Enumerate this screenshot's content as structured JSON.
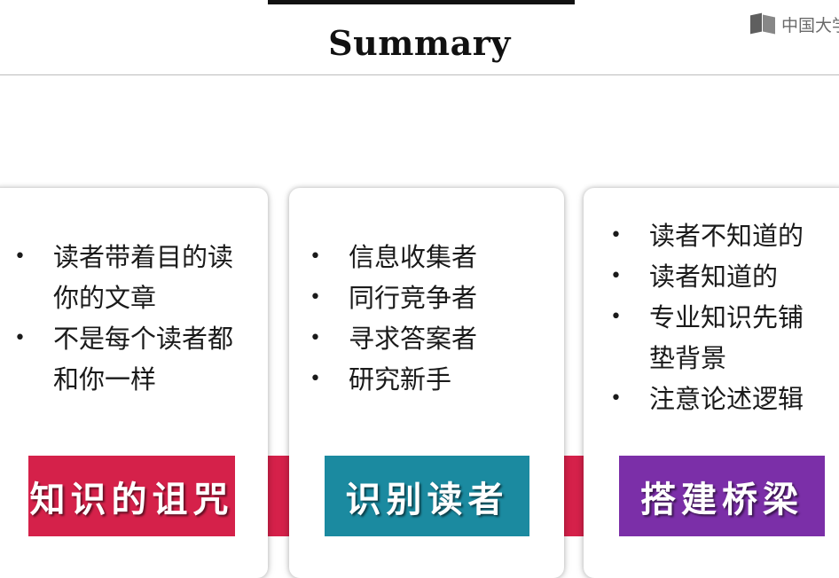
{
  "slide": {
    "title": "Summary",
    "watermark": "中国大学"
  },
  "cards": [
    {
      "bullets": [
        "读者带着目的读你的文章",
        "不是每个读者都和你一样"
      ],
      "label": "知识的诅咒",
      "color": "#d5214a"
    },
    {
      "bullets": [
        "信息收集者",
        "同行竞争者",
        "寻求答案者",
        "研究新手"
      ],
      "label": "识别读者",
      "color": "#1b8aa0"
    },
    {
      "bullets": [
        "读者不知道的",
        "读者知道的",
        "专业知识先铺垫背景",
        "注意论述逻辑"
      ],
      "label": "搭建桥梁",
      "color": "#7b2fa8"
    }
  ],
  "connector_color": "#d5214a"
}
